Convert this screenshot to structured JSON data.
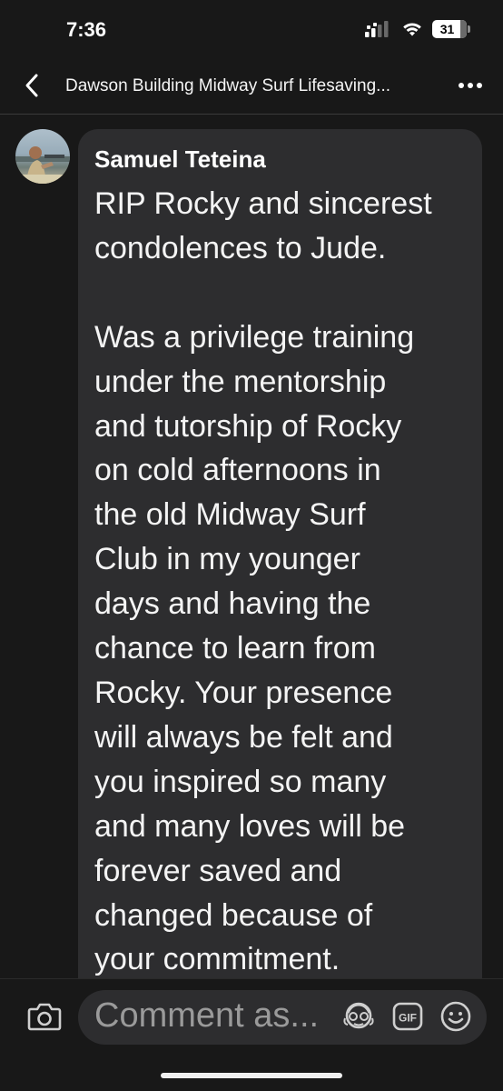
{
  "status_bar": {
    "time": "7:36",
    "battery": "31"
  },
  "header": {
    "title": "Dawson Building Midway Surf Lifesaving..."
  },
  "comment": {
    "author": "Samuel Teteina",
    "text": "RIP Rocky and sincerest\ncondolences to Jude.\n\nWas a privilege training\nunder the mentorship\nand tutorship of Rocky\non cold afternoons in\nthe old Midway Surf\nClub in my younger\ndays and having the\nchance to learn from\nRocky. Your presence\nwill always be felt and\nyou inspired so many\nand many loves will be\nforever saved and\nchanged because of\nyour commitment."
  },
  "composer": {
    "placeholder": "Comment as...",
    "gif_label": "GIF"
  },
  "icons": {
    "back": "chevron-left-icon",
    "more": "more-horizontal-icon",
    "camera": "camera-icon",
    "avatar_sticker": "avatar-sticker-icon",
    "gif": "gif-icon",
    "emoji": "smiley-icon"
  },
  "colors": {
    "background": "#181818",
    "bubble": "#2d2d2f",
    "text": "#f4f4f4",
    "placeholder": "#9a9a9a"
  }
}
